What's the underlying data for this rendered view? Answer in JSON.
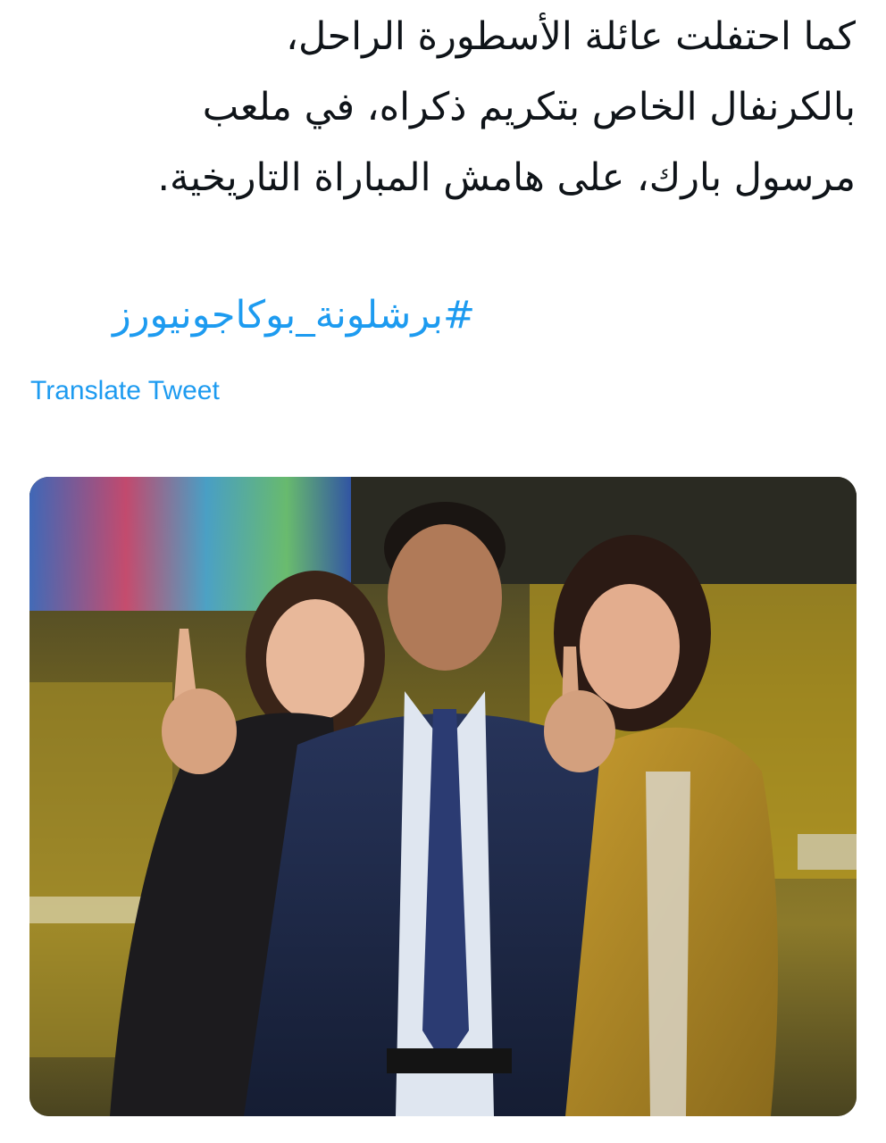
{
  "tweet": {
    "text_lines": [
      "كما احتفلت عائلة الأسطورة الراحل،",
      "بالكرنفال الخاص بتكريم ذكراه، في ملعب",
      "مرسول بارك، على هامش المباراة التاريخية."
    ],
    "hashtag": "#برشلونة_بوكاجونيورز",
    "translate_label": "Translate Tweet"
  },
  "media": {
    "type": "photo",
    "icon": "photo-image",
    "colors": {
      "accent_link": "#1d9bf0",
      "text": "#0f1419",
      "stadium_yellow": "#d9b820",
      "jacket_mustard": "#b38a24",
      "suit_navy": "#1f2a44"
    }
  }
}
